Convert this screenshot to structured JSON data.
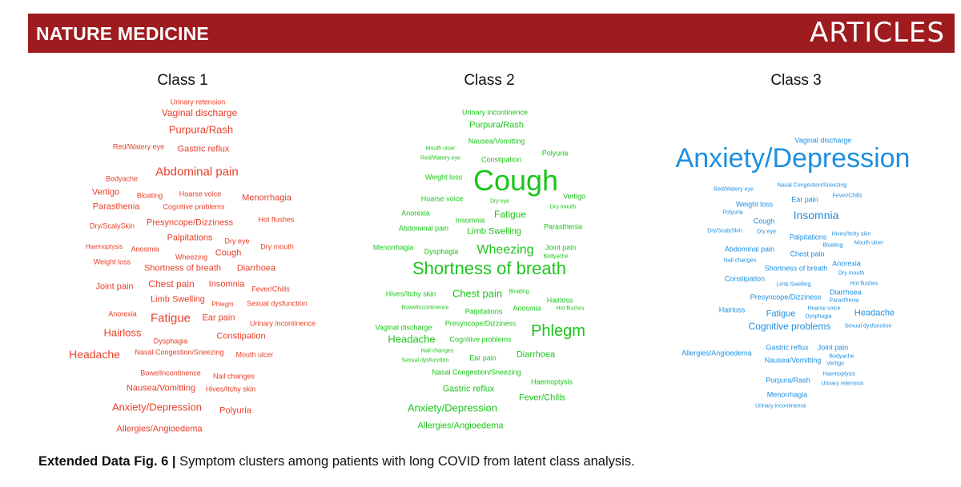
{
  "header": {
    "journal": "NATURE MEDICINE",
    "section": "ARTICLES",
    "bar_color": "#9e1b1f"
  },
  "class_titles": [
    "Class 1",
    "Class 2",
    "Class 3"
  ],
  "colors": {
    "class1": "#e8402a",
    "class2": "#1bc41b",
    "class3": "#1e8fe0"
  },
  "clouds": [
    {
      "class": "Class 1",
      "words": [
        "Urinary retension",
        "Vaginal discharge",
        "Purpura/Rash",
        "Red/Watery eye",
        "Gastric reflux",
        "Abdominal pain",
        "Bodyache",
        "Vertigo",
        "Bloating",
        "Hoarse voice",
        "Menorrhagia",
        "Parasthenia",
        "Cognitive problems",
        "Presyncope/Dizziness",
        "Hot flushes",
        "Dry/ScalySkin",
        "Palpitations",
        "Dry eye",
        "Haemoptysis",
        "Anosmia",
        "Dry mouth",
        "Weight loss",
        "Wheezing",
        "Cough",
        "Shortness of breath",
        "Diarrhoea",
        "Chest pain",
        "Joint pain",
        "Insomnia",
        "Fever/Chills",
        "Limb Swelling",
        "Phlegm",
        "Sexual dysfunction",
        "Anorexia",
        "Fatigue",
        "Ear pain",
        "Urinary incontinence",
        "Hairloss",
        "Constipation",
        "Dysphagia",
        "Headache",
        "Nasal Congestion/Sneezing",
        "Mouth ulcer",
        "BowelIncontinence",
        "Nail changes",
        "Nausea/Vomitting",
        "Hives/Itchy skin",
        "Anxiety/Depression",
        "Polyuria",
        "Allergies/Angioedema"
      ]
    },
    {
      "class": "Class 2",
      "words": [
        "Urinary incontinence",
        "Purpura/Rash",
        "Nausea/Vomitting",
        "Mouth ulcer",
        "Polyuria",
        "Red/Watery eye",
        "Constipation",
        "Weight loss",
        "Cough",
        "Hoarse voice",
        "Dry eye",
        "Vertigo",
        "Dry mouth",
        "Anorexia",
        "Fatigue",
        "Insomnia",
        "Parasthenia",
        "Abdominal pain",
        "Limb Swelling",
        "Menorrhagia",
        "Dysphagia",
        "Wheezing",
        "Joint pain",
        "Bodyache",
        "Shortness of breath",
        "Hives/Itchy skin",
        "Chest pain",
        "Bloating",
        "Hairloss",
        "BowelIncontinence",
        "Palpitations",
        "Anosmia",
        "Hot flushes",
        "Vaginal discharge",
        "Presyncope/Dizziness",
        "Phlegm",
        "Headache",
        "Cognitive problems",
        "Nail changes",
        "Ear pain",
        "Diarrhoea",
        "Sexual dysfunction",
        "Nasal Congestion/Sneezing",
        "Haemoptysis",
        "Gastric reflux",
        "Fever/Chills",
        "Anxiety/Depression",
        "Allergies/Angioedema"
      ]
    },
    {
      "class": "Class 3",
      "words": [
        "Vaginal discharge",
        "Anxiety/Depression",
        "Nasal Congestion/Sneezing",
        "Red/Watery eye",
        "Fever/Chills",
        "Ear pain",
        "Weight loss",
        "Insomnia",
        "Polyuria",
        "Cough",
        "Dry/ScalySkin",
        "Dry eye",
        "Hives/Itchy skin",
        "Palpitations",
        "Bloating",
        "Mouth ulcer",
        "Abdominal pain",
        "Chest pain",
        "Nail changes",
        "Anorexia",
        "Shortness of breath",
        "Dry mouth",
        "Constipation",
        "Limb Swelling",
        "Hot flushes",
        "Diarrhoea",
        "Parasthenia",
        "Presyncope/Dizziness",
        "Hairloss",
        "Hoarse voice",
        "Fatigue",
        "Dysphagia",
        "Headache",
        "Cognitive problems",
        "Sexual dysfunction",
        "Gastric reflux",
        "Joint pain",
        "Allergies/Angioedema",
        "Bodyache",
        "Nausea/Vomitting",
        "Vertigo",
        "Haemoptysis",
        "Purpura/Rash",
        "Urinary retension",
        "Menorrhagia",
        "Urinary incontinence"
      ]
    }
  ],
  "caption": {
    "label": "Extended Data Fig. 6 |",
    "text": " Symptom clusters among patients with long COVID from latent class analysis."
  }
}
